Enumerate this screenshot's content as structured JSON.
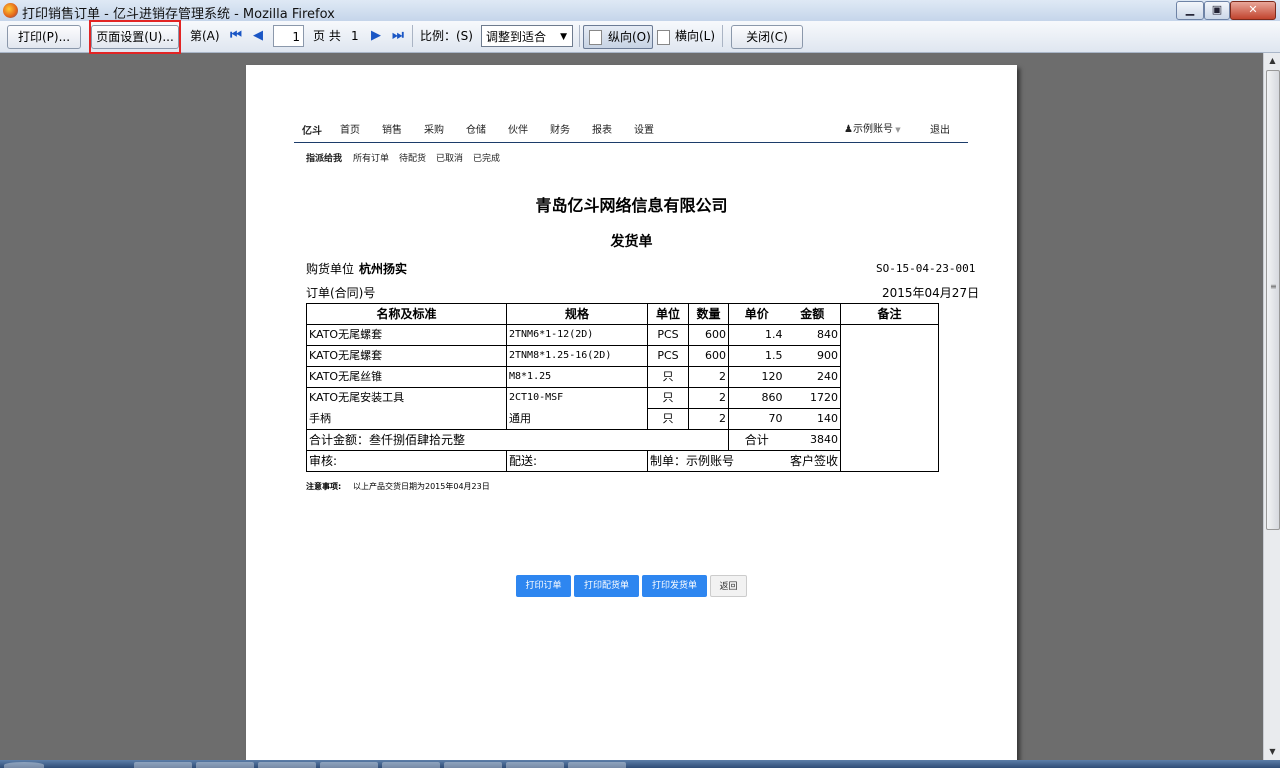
{
  "window": {
    "title": "打印销售订单 - 亿斗进销存管理系统 - Mozilla Firefox",
    "minimize": "▁",
    "maximize": "▣",
    "close": "✕"
  },
  "toolbar": {
    "print": "打印(P)...",
    "page_setup": "页面设置(U)...",
    "page_prefix": "第(A)",
    "first_icon": "⏮",
    "prev_icon": "◀",
    "page_value": "1",
    "page_of": "页 共",
    "page_total": "1",
    "next_icon": "▶",
    "last_icon": "⏭",
    "scale_label": "比例：(S)",
    "scale_value": "调整到适合",
    "portrait": "纵向(O)",
    "landscape": "横向(L)",
    "close": "关闭(C)"
  },
  "site": {
    "brand": "亿斗",
    "nav": [
      "首页",
      "销售",
      "采购",
      "仓储",
      "伙伴",
      "财务",
      "报表",
      "设置"
    ],
    "user": "示例账号",
    "logout": "退出",
    "subnav": [
      "指派给我",
      "所有订单",
      "待配货",
      "已取消",
      "已完成"
    ]
  },
  "doc": {
    "company": "青岛亿斗网络信息有限公司",
    "title": "发货单",
    "buyer_label": "购货单位",
    "buyer": "杭州扬实",
    "order_no": "SO-15-04-23-001",
    "contract_label": "订单(合同)号",
    "date": "2015年04月27日",
    "headers": [
      "名称及标准",
      "规格",
      "单位",
      "数量",
      "单价",
      "金额",
      "备注"
    ],
    "rows": [
      {
        "name": "KATO无尾螺套",
        "spec": "2TNM6*1-12(2D)",
        "unit": "PCS",
        "qty": "600",
        "price": "1.4",
        "amount": "840"
      },
      {
        "name": "KATO无尾螺套",
        "spec": "2TNM8*1.25-16(2D)",
        "unit": "PCS",
        "qty": "600",
        "price": "1.5",
        "amount": "900"
      },
      {
        "name": "KATO无尾丝锥",
        "spec": "M8*1.25",
        "unit": "只",
        "qty": "2",
        "price": "120",
        "amount": "240"
      },
      {
        "name": "KATO无尾安装工具",
        "spec": "2CT10-MSF",
        "unit": "只",
        "qty": "2",
        "price": "860",
        "amount": "1720"
      },
      {
        "name": "手柄",
        "spec": "通用",
        "unit": "只",
        "qty": "2",
        "price": "70",
        "amount": "140"
      }
    ],
    "total_words": "合计金额：叁仟捌佰肆拾元整",
    "total_label": "合计",
    "total_value": "3840",
    "review_label": "审核:",
    "delivery_label": "配送:",
    "maker": "制单：示例账号",
    "signoff": "客户签收",
    "note_label": "注意事项:",
    "note": "以上产品交货日期为2015年04月23日"
  },
  "actions": {
    "print_order": "打印订单",
    "print_picking": "打印配货单",
    "print_delivery": "打印发货单",
    "back": "返回"
  },
  "colors": {
    "accent_blue": "#2e86f0",
    "highlight": "#e22424",
    "nav_line": "#1c3c6a"
  }
}
